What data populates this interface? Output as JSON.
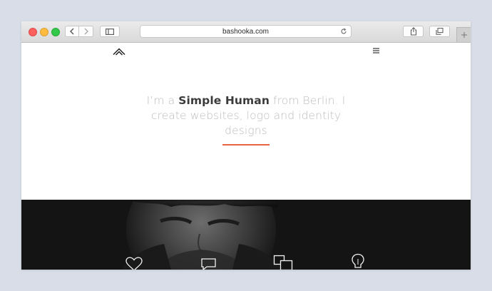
{
  "browser": {
    "url": "bashooka.com",
    "traffic_colors": {
      "close": "#fc605c",
      "minimize": "#fdbc40",
      "zoom": "#34c84a"
    },
    "icons": [
      "back-icon",
      "forward-icon",
      "sidebar-icon",
      "reload-icon",
      "share-icon",
      "tabs-icon",
      "new-tab-icon"
    ]
  },
  "site": {
    "logo_icon": "double-chevron-up-icon",
    "menu_icon": "hamburger-menu-icon",
    "hero": {
      "prefix": "I’m a ",
      "highlight": "Simple Human",
      "suffix": " from Berlin. I create websites, logo and identity designs"
    },
    "accent_color": "#e7643f",
    "features": [
      "heart-icon",
      "chat-bubble-icon",
      "layers-icon",
      "lightbulb-icon"
    ]
  }
}
